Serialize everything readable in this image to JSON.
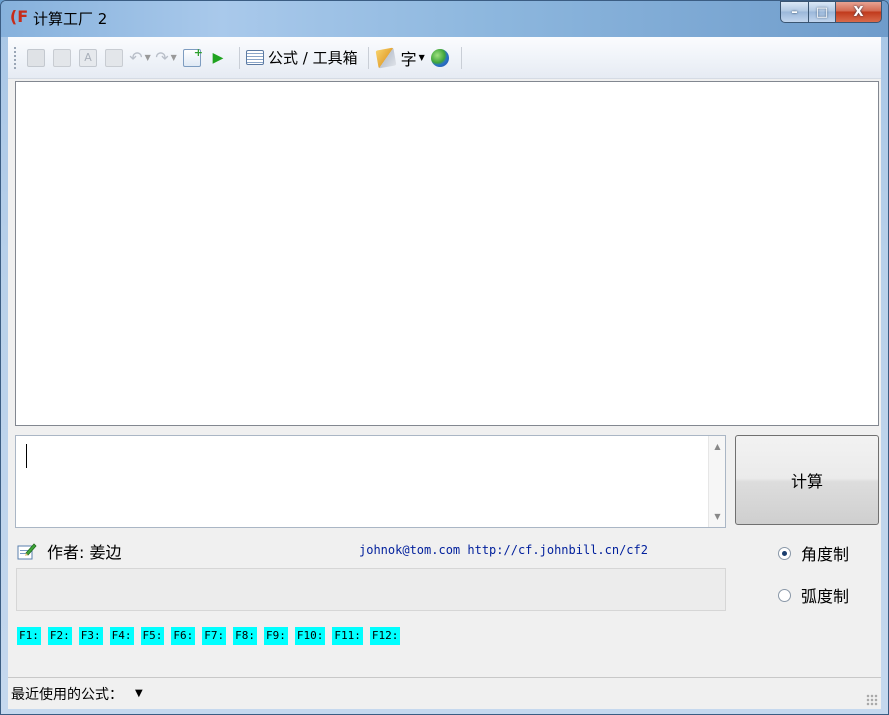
{
  "window": {
    "title": "计算工厂 2",
    "app_icon_glyph": "(F",
    "minimize_glyph": "–",
    "maximize_glyph": "□",
    "close_glyph": "X"
  },
  "toolbar": {
    "items": [
      {
        "name": "image-icon",
        "enabled": false
      },
      {
        "name": "copy-image-icon",
        "enabled": false
      },
      {
        "name": "text-a-icon",
        "enabled": false
      },
      {
        "name": "copy-text-icon",
        "enabled": false
      },
      {
        "name": "undo-icon",
        "enabled": false
      },
      {
        "name": "redo-icon",
        "enabled": false
      },
      {
        "name": "export-icon",
        "enabled": true
      },
      {
        "name": "run-icon",
        "enabled": true
      }
    ],
    "formula_toolbox_label": "公式 / 工具箱",
    "font_label": "字"
  },
  "calc_button_label": "计算",
  "author_text": "作者: 姜边",
  "links_text": "johnok@tom.com  http://cf.johnbill.cn/cf2",
  "angle_mode": {
    "degrees_label": "角度制",
    "radians_label": "弧度制",
    "selected": "degrees"
  },
  "fkeys": [
    "F1:",
    "F2:",
    "F3:",
    "F4:",
    "F5:",
    "F6:",
    "F7:",
    "F8:",
    "F9:",
    "F10:",
    "F11:",
    "F12:"
  ],
  "statusbar": {
    "recent_label": "最近使用的公式："
  },
  "colors": {
    "fkey_bg": "#00ffff",
    "link": "#001f9c",
    "close_button": "#c13a1c"
  }
}
